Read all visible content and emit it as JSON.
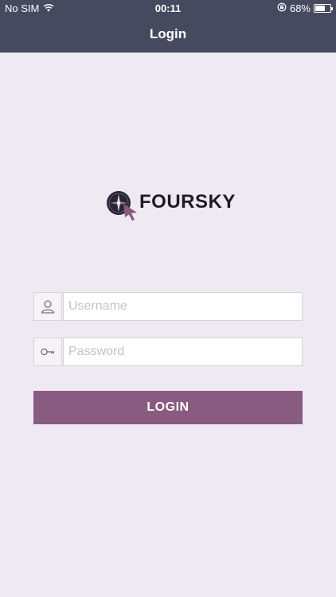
{
  "status_bar": {
    "carrier": "No SIM",
    "time": "00:11",
    "battery_percent_label": "68%",
    "battery_level": 0.68,
    "icons": [
      "wifi-icon",
      "orientation-lock-icon",
      "battery-icon"
    ]
  },
  "nav": {
    "title": "Login"
  },
  "logo": {
    "text": "FOURSKY",
    "icon": "compass-cursor-logo"
  },
  "form": {
    "username": {
      "placeholder": "Username",
      "value": "",
      "icon": "user-icon"
    },
    "password": {
      "placeholder": "Password",
      "value": "",
      "icon": "key-icon"
    },
    "submit_label": "LOGIN"
  },
  "colors": {
    "header_bg": "#464a5f",
    "page_bg": "#efeaf1",
    "accent": "#895b80",
    "logo_text": "#1e1b24"
  }
}
